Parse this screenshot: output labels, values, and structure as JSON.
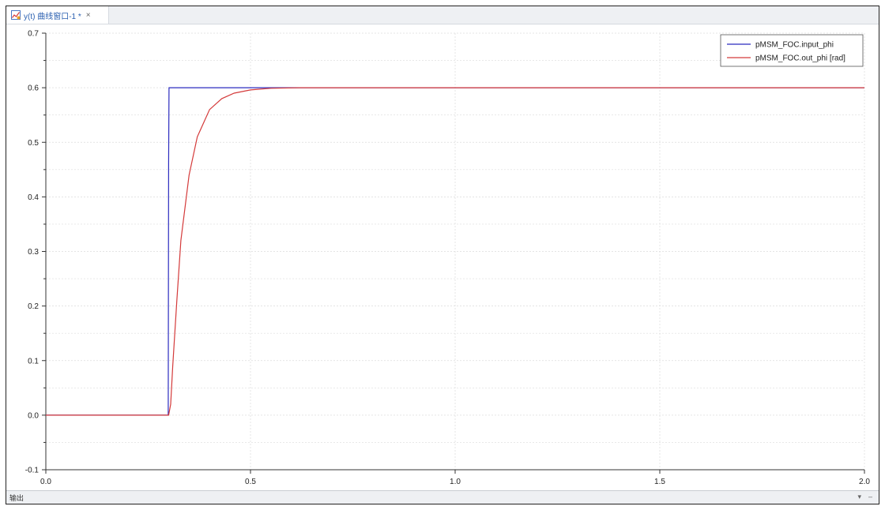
{
  "tab": {
    "title": "y(t) 曲线窗口-1 *",
    "close": "×",
    "icon": "chart-icon"
  },
  "status": {
    "label": "输出",
    "dropdown": "▾",
    "minimize": "–"
  },
  "colors": {
    "input": "#2b2bbf",
    "output": "#d43a3a",
    "grid": "#dcdcdc"
  },
  "chart_data": {
    "type": "line",
    "title": "",
    "xlabel": "",
    "ylabel": "",
    "xlim": [
      0.0,
      2.0
    ],
    "ylim": [
      -0.1,
      0.7
    ],
    "xticks": [
      "0.0",
      "0.5",
      "1.0",
      "1.5",
      "2.0"
    ],
    "yticks": [
      "-0.1",
      "0.0",
      "0.1",
      "0.2",
      "0.3",
      "0.4",
      "0.5",
      "0.6",
      "0.7"
    ],
    "grid": true,
    "legend_position": "top-right",
    "series": [
      {
        "name": "pMSM_FOC.input_phi",
        "color": "#2b2bbf",
        "x": [
          0.0,
          0.299,
          0.3,
          0.301,
          0.31,
          0.62,
          2.0
        ],
        "y": [
          0.0,
          0.0,
          0.46,
          0.6,
          0.6,
          0.6,
          0.6
        ]
      },
      {
        "name": "pMSM_FOC.out_phi [rad]",
        "color": "#d43a3a",
        "x": [
          0.0,
          0.3,
          0.305,
          0.31,
          0.32,
          0.33,
          0.35,
          0.37,
          0.4,
          0.43,
          0.46,
          0.5,
          0.55,
          0.62,
          2.0
        ],
        "y": [
          0.0,
          0.0,
          0.02,
          0.09,
          0.21,
          0.32,
          0.44,
          0.51,
          0.56,
          0.58,
          0.59,
          0.596,
          0.599,
          0.6,
          0.6
        ]
      }
    ]
  }
}
